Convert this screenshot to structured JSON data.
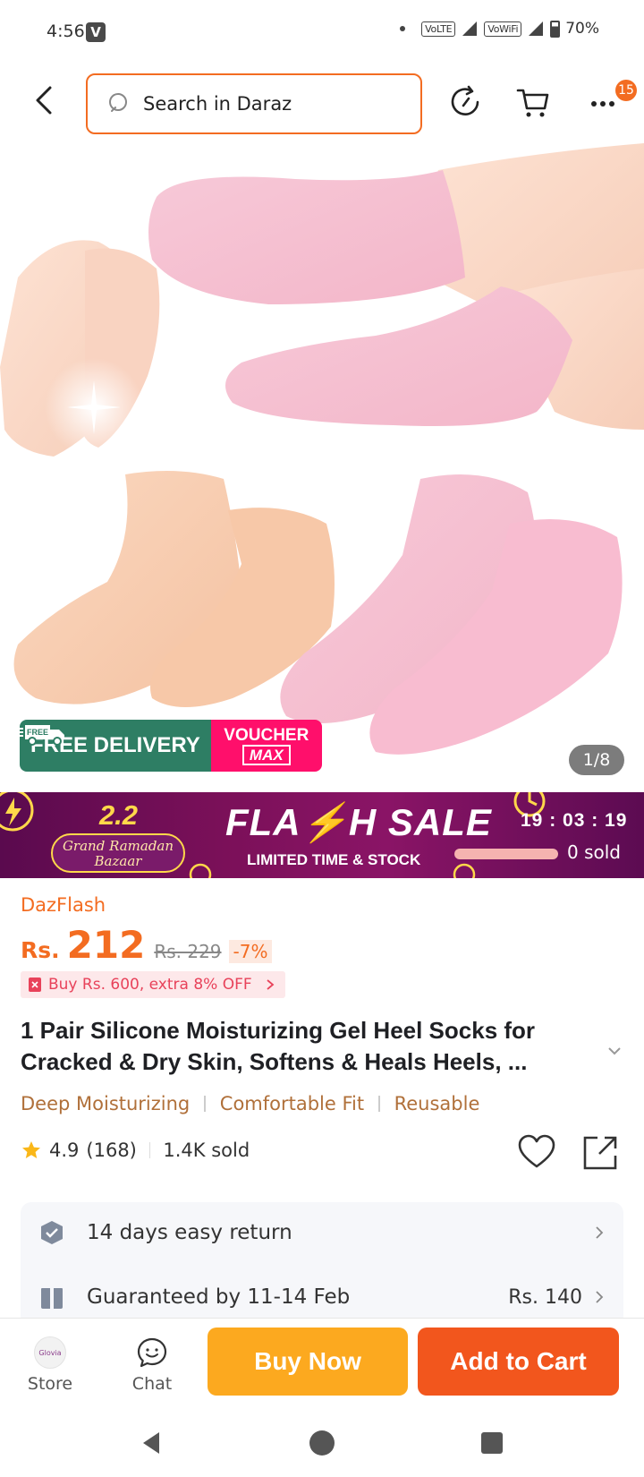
{
  "status_bar": {
    "time": "4:56",
    "v_badge": "V",
    "net1": "VoLTE",
    "net2": "VoWiFi",
    "battery": "70%"
  },
  "header": {
    "search_placeholder": "Search in Daraz",
    "cart_badge": "15"
  },
  "gallery": {
    "counter": "1/8",
    "free_badge": "FREE",
    "delivery_label": "FREE DELIVERY",
    "voucher_label": "VOUCHER",
    "voucher_max": "MAX"
  },
  "flash_sale": {
    "event_number": "2.2",
    "event_name_line1": "Grand Ramadan",
    "event_name_line2": "Bazaar",
    "title": "FLA⚡H SALE",
    "subtitle": "LIMITED TIME & STOCK",
    "countdown": "19 : 03 : 19",
    "sold_fraction": 0.0,
    "sold_text": "0 sold"
  },
  "product": {
    "seller_tag": "DazFlash",
    "currency": "Rs.",
    "price": "212",
    "old_price": "Rs. 229",
    "discount": "-7%",
    "promo": "Buy Rs. 600, extra 8% OFF",
    "title": "1 Pair Silicone Moisturizing Gel Heel Socks for Cracked & Dry Skin, Softens & Heals Heels, ...",
    "features": [
      "Deep Moisturizing",
      "Comfortable Fit",
      "Reusable"
    ],
    "rating": "4.9",
    "review_count": "(168)",
    "sold": "1.4K sold"
  },
  "services": {
    "return_text": "14 days easy return",
    "delivery_text": "Guaranteed by 11-14 Feb",
    "delivery_fee": "Rs. 140"
  },
  "actions": {
    "store_label": "Store",
    "store_logo_text": "Glovia",
    "chat_label": "Chat",
    "buy_now": "Buy Now",
    "add_to_cart": "Add to Cart"
  },
  "colors": {
    "brand_orange": "#f36c21",
    "buy_now": "#fca91f",
    "add_cart": "#f2561d",
    "delivery_green": "#2e7e64",
    "voucher_pink": "#ff0f6b",
    "flash_purple": "#7b1059"
  }
}
